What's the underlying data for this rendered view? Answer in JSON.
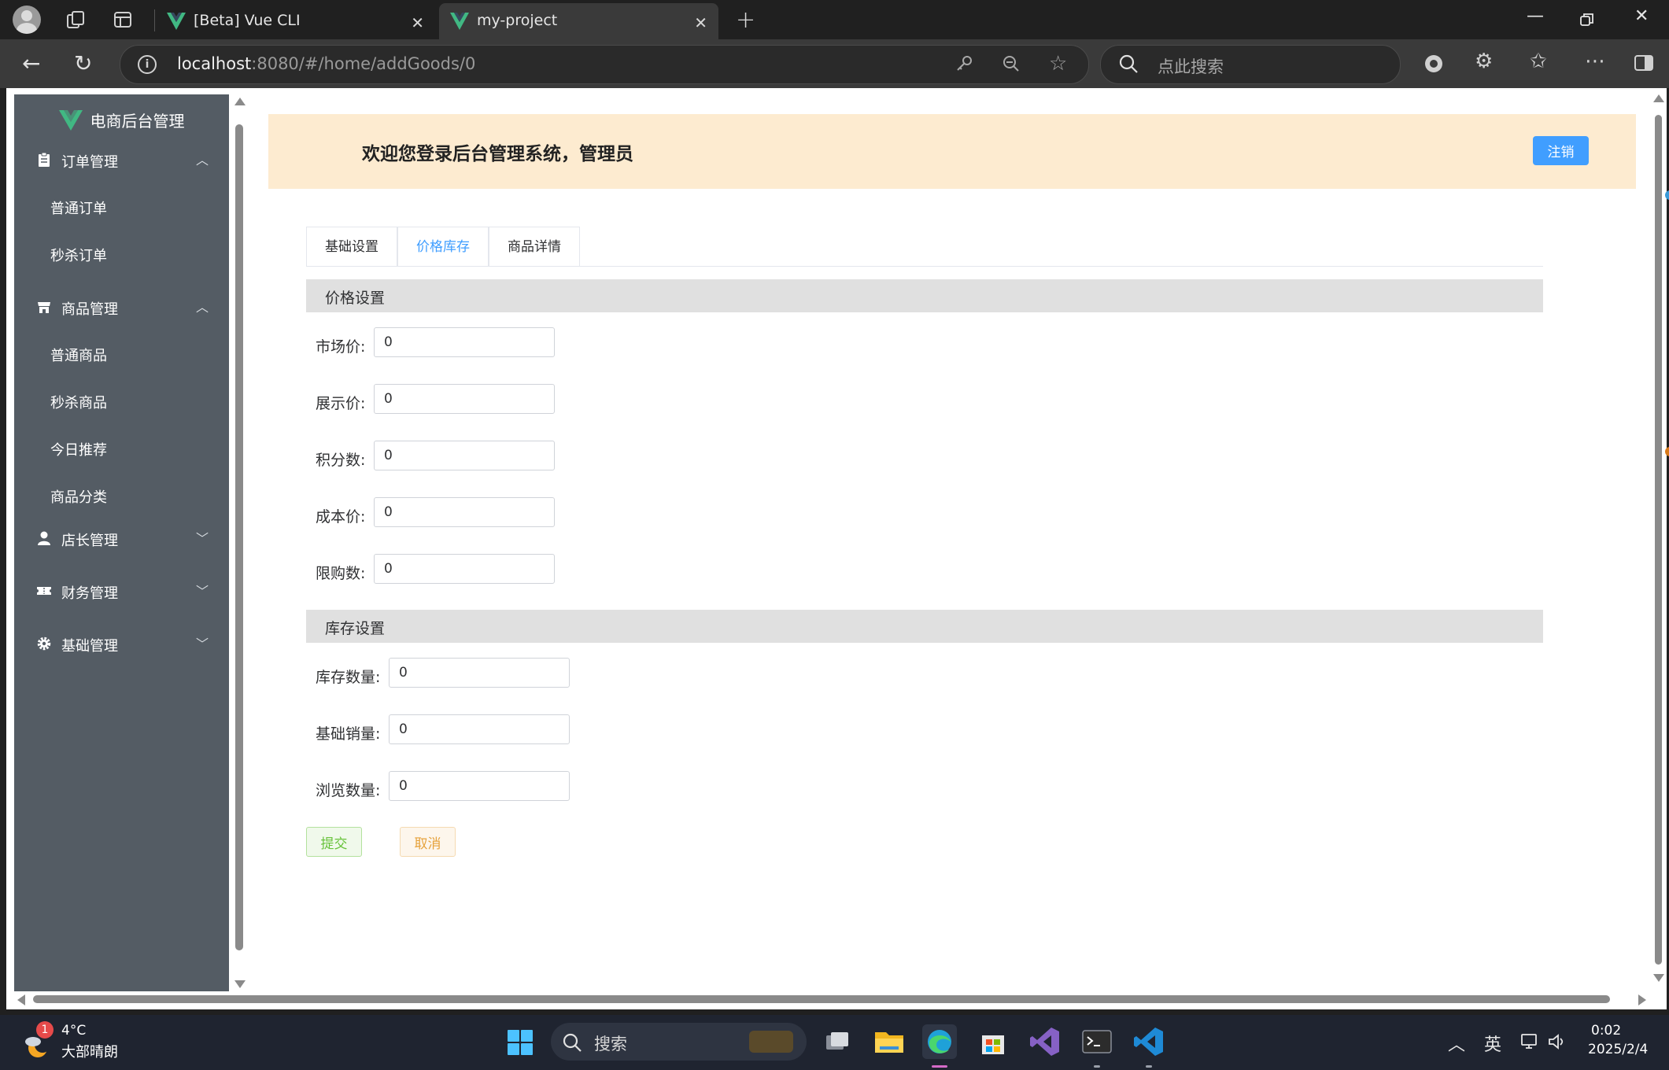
{
  "browser": {
    "tabs": [
      {
        "title": "[Beta] Vue CLI",
        "active": false
      },
      {
        "title": "my-project",
        "active": true
      }
    ],
    "url_host": "localhost",
    "url_rest": ":8080/#/home/addGoods/0",
    "search_placeholder": "点此搜索"
  },
  "app": {
    "logo_title": "电商后台管理",
    "welcome_message": "欢迎您登录后台管理系统，管理员",
    "logout_label": "注销"
  },
  "sidebar": {
    "groups": [
      {
        "label": "订单管理",
        "icon": "clipboard-icon",
        "expanded": true,
        "items": [
          "普通订单",
          "秒杀订单"
        ]
      },
      {
        "label": "商品管理",
        "icon": "shop-icon",
        "expanded": true,
        "items": [
          "普通商品",
          "秒杀商品",
          "今日推荐",
          "商品分类"
        ]
      },
      {
        "label": "店长管理",
        "icon": "user-icon",
        "expanded": false,
        "items": []
      },
      {
        "label": "财务管理",
        "icon": "ticket-icon",
        "expanded": false,
        "items": []
      },
      {
        "label": "基础管理",
        "icon": "gear-icon",
        "expanded": false,
        "items": []
      }
    ]
  },
  "tabs": [
    {
      "label": "基础设置",
      "active": false
    },
    {
      "label": "价格库存",
      "active": true
    },
    {
      "label": "商品详情",
      "active": false
    }
  ],
  "price_section": {
    "title": "价格设置",
    "fields": [
      {
        "label": "市场价:",
        "value": "0"
      },
      {
        "label": "展示价:",
        "value": "0"
      },
      {
        "label": "积分数:",
        "value": "0"
      },
      {
        "label": "成本价:",
        "value": "0"
      },
      {
        "label": "限购数:",
        "value": "0"
      }
    ]
  },
  "stock_section": {
    "title": "库存设置",
    "fields": [
      {
        "label": "库存数量:",
        "value": "0"
      },
      {
        "label": "基础销量:",
        "value": "0"
      },
      {
        "label": "浏览数量:",
        "value": "0"
      }
    ]
  },
  "buttons": {
    "submit": "提交",
    "cancel": "取消"
  },
  "taskbar": {
    "weather_badge": "1",
    "weather_temp": "4°C",
    "weather_desc": "大部晴朗",
    "search_placeholder": "搜索",
    "ime": "英",
    "time": "0:02",
    "date": "2025/2/4"
  },
  "colors": {
    "sidebar_bg": "#545c64",
    "primary": "#409eff",
    "welcome_bg": "#fdebd0",
    "success": "#67c23a",
    "warning": "#e6a23c"
  }
}
